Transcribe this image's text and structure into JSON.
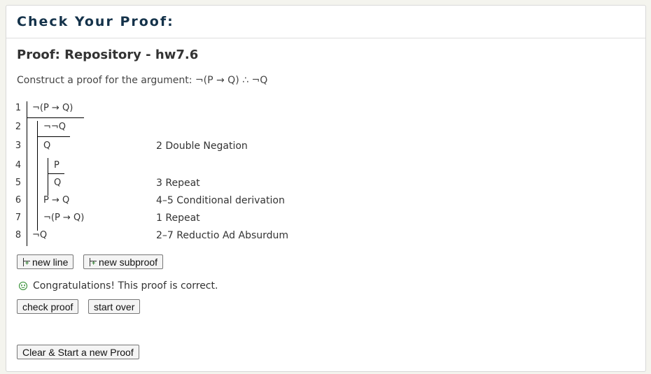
{
  "header": {
    "title": "Check Your Proof:"
  },
  "proof": {
    "title": "Proof: Repository - hw7.6",
    "instruction_prefix": "Construct a proof for the argument: ",
    "instruction_formula": "¬(P → Q) ∴ ¬Q",
    "lines": [
      {
        "no": "1",
        "formula": "¬(P → Q)",
        "justification": ""
      },
      {
        "no": "2",
        "formula": "¬¬Q",
        "justification": ""
      },
      {
        "no": "3",
        "formula": "Q",
        "justification": "2 Double Negation"
      },
      {
        "no": "4",
        "formula": "P",
        "justification": ""
      },
      {
        "no": "5",
        "formula": "Q",
        "justification": "3 Repeat"
      },
      {
        "no": "6",
        "formula": "P → Q",
        "justification": "4–5 Conditional derivation"
      },
      {
        "no": "7",
        "formula": "¬(P → Q)",
        "justification": "1 Repeat"
      },
      {
        "no": "8",
        "formula": "¬Q",
        "justification": "2–7 Reductio Ad Absurdum"
      }
    ]
  },
  "buttons": {
    "new_line": "new line",
    "new_subproof": "new subproof",
    "check_proof": "check proof",
    "start_over": "start over",
    "clear_new": "Clear & Start a new Proof"
  },
  "status": {
    "message": "Congratulations! This proof is correct."
  },
  "colors": {
    "header_text": "#14324a",
    "success": "#2a8a2a",
    "page_bg": "#f4f4ee"
  }
}
